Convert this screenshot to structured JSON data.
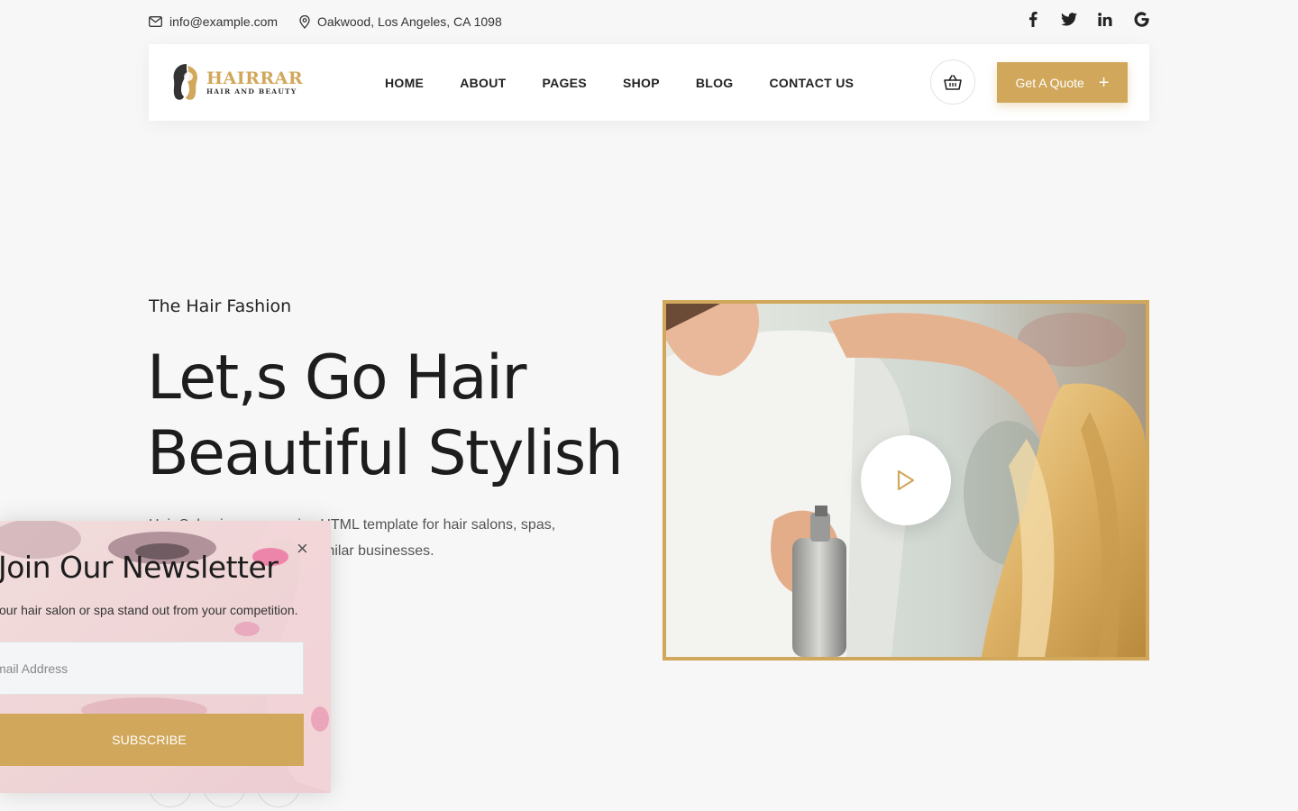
{
  "topbar": {
    "email": "info@example.com",
    "address": "Oakwood, Los Angeles, CA 1098",
    "social": [
      {
        "name": "facebook-icon",
        "glyph": "f"
      },
      {
        "name": "twitter-icon",
        "glyph": "t"
      },
      {
        "name": "linkedin-icon",
        "glyph": "in"
      },
      {
        "name": "google-icon",
        "glyph": "G"
      }
    ]
  },
  "brand": {
    "name": "HAIRRAR",
    "tagline": "HAIR AND BEAUTY",
    "accent": "#d1a85b"
  },
  "nav": {
    "items": [
      "HOME",
      "ABOUT",
      "PAGES",
      "SHOP",
      "BLOG",
      "CONTACT US"
    ],
    "quote_label": "Get A Quote",
    "quote_icon": "+"
  },
  "hero": {
    "subtitle": "The Hair Fashion",
    "title_line1": "Let,s Go Hair",
    "title_line2": "Beautiful Stylish",
    "description": "Hair Salon is a responsive HTML template for hair salons, spas, beauty centers and other similar businesses."
  },
  "newsletter": {
    "title": "Join Our Newsletter",
    "description": "your hair salon or spa stand out from your competition.",
    "email_placeholder": "mail Address",
    "subscribe_label": "SUBSCRIBE",
    "close_glyph": "×"
  }
}
